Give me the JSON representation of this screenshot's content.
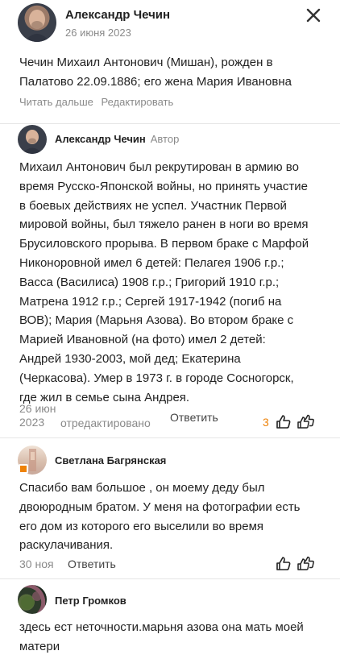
{
  "post": {
    "author": "Александр Чечин",
    "date": "26 июня 2023",
    "text_line1": "Чечин Михаил Антонович (Мишан), рожден в",
    "text_line2": "Палатово 22.09.1886; его жена Мария Ивановна",
    "read_more": "Читать дальше",
    "edit": "Редактировать"
  },
  "comments": [
    {
      "author": "Александр Чечин",
      "role": "Автор",
      "lines": [
        "Михаил Антонович был рекрутирован в армию во",
        "время Русско-Японской войны, но принять участие",
        "в боевых действиях не успел. Участник Первой",
        "мировой войны, был тяжело ранен в ноги во время",
        "Брусиловского прорыва. В первом браке с Марфой",
        "Никоноровной имел 6 детей: Пелагея 1906 г.р.;",
        "Васса (Василиса) 1908 г.р.; Григорий 1910 г.р.;",
        "Матрена 1912 г.р.; Сергей 1917-1942 (погиб на",
        "ВОВ); Мария (Марьня Азова). Во втором браке с",
        "Марией Ивановной (на фото) имел 2 детей:",
        "Андрей 1930-2003, мой дед; Екатерина",
        "(Черкасова). Умер в 1973 г. в городе Сосногорск,",
        "где жил в семье сына Андрея."
      ],
      "date_line1": "26 июн",
      "date_line2": "2023",
      "edited": "отредактировано",
      "reply": "Ответить",
      "likes": "3"
    },
    {
      "author": "Светлана Багрянская",
      "lines": [
        "Спасибо вам большое , он моему деду был",
        "двоюродным братом. У меня на фотографии есть",
        "его дом из которого его выселили во время",
        "раскулачивания."
      ],
      "date": "30 ноя",
      "reply": "Ответить"
    },
    {
      "author": "Петр Громков",
      "lines": [
        "здесь ест неточности.марьня азова она мать моей",
        "матери"
      ]
    }
  ],
  "icons": {
    "close": "close-icon",
    "like": "thumbs-up-icon",
    "class": "double-thumbs-up-icon"
  },
  "colors": {
    "accent": "#ee8208",
    "text": "#222222",
    "muted": "#8a8a8a",
    "divider": "#e6e6e6"
  }
}
